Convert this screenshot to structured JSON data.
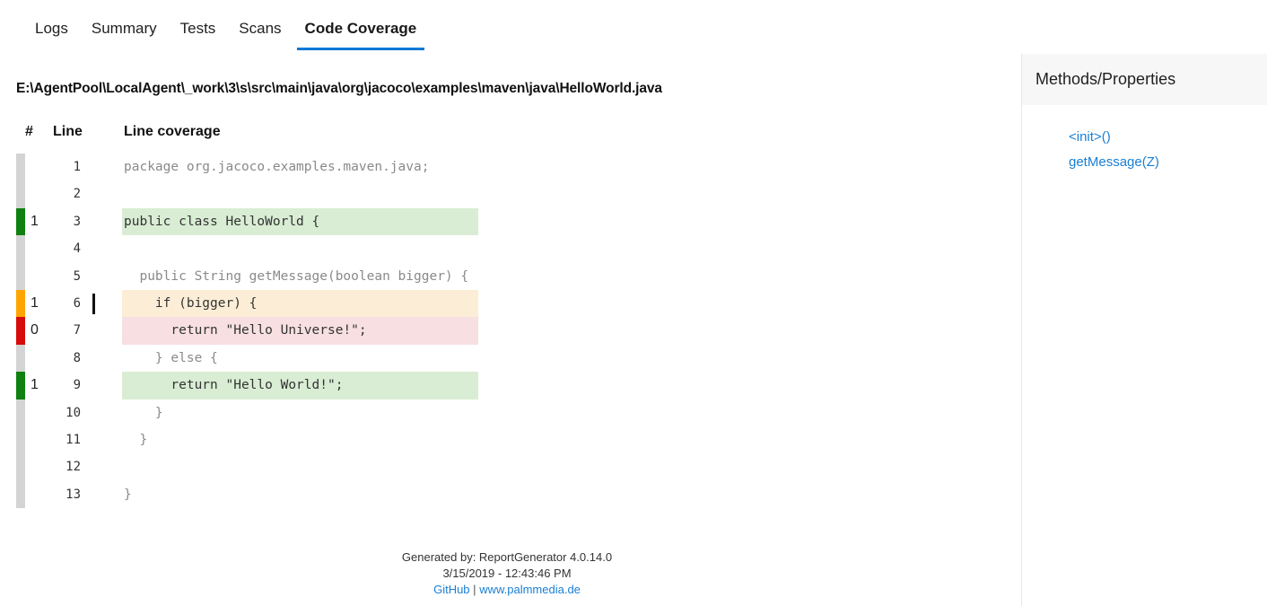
{
  "tabs": [
    {
      "label": "Logs",
      "active": false
    },
    {
      "label": "Summary",
      "active": false
    },
    {
      "label": "Tests",
      "active": false
    },
    {
      "label": "Scans",
      "active": false
    },
    {
      "label": "Code Coverage",
      "active": true
    }
  ],
  "file": {
    "path": "E:\\AgentPool\\LocalAgent\\_work\\3\\s\\src\\main\\java\\org\\jacoco\\examples\\maven\\java\\HelloWorld.java"
  },
  "table": {
    "headers": {
      "hash": "#",
      "line": "Line",
      "coverage": "Line coverage"
    },
    "rows": [
      {
        "status": "gray",
        "hits": "",
        "line": "1",
        "code": "package org.jacoco.examples.maven.java;",
        "cov": "none-code",
        "branch": false
      },
      {
        "status": "gray",
        "hits": "",
        "line": "2",
        "code": "",
        "cov": "none-code",
        "branch": false
      },
      {
        "status": "green",
        "hits": "1",
        "line": "3",
        "code": "public class HelloWorld {",
        "cov": "full",
        "branch": false
      },
      {
        "status": "gray",
        "hits": "",
        "line": "4",
        "code": "",
        "cov": "none-code",
        "branch": false
      },
      {
        "status": "gray",
        "hits": "",
        "line": "5",
        "code": "  public String getMessage(boolean bigger) {",
        "cov": "none-code",
        "branch": false
      },
      {
        "status": "orange",
        "hits": "1",
        "line": "6",
        "code": "    if (bigger) {",
        "cov": "partial",
        "branch": true
      },
      {
        "status": "red",
        "hits": "0",
        "line": "7",
        "code": "      return \"Hello Universe!\";",
        "cov": "uncovered",
        "branch": false
      },
      {
        "status": "gray",
        "hits": "",
        "line": "8",
        "code": "    } else {",
        "cov": "none-code",
        "branch": false
      },
      {
        "status": "green",
        "hits": "1",
        "line": "9",
        "code": "      return \"Hello World!\";",
        "cov": "full",
        "branch": false
      },
      {
        "status": "gray",
        "hits": "",
        "line": "10",
        "code": "    }",
        "cov": "none-code",
        "branch": false
      },
      {
        "status": "gray",
        "hits": "",
        "line": "11",
        "code": "  }",
        "cov": "none-code",
        "branch": false
      },
      {
        "status": "gray",
        "hits": "",
        "line": "12",
        "code": "",
        "cov": "none-code",
        "branch": false
      },
      {
        "status": "gray",
        "hits": "",
        "line": "13",
        "code": "}",
        "cov": "none-code",
        "branch": false
      }
    ]
  },
  "sidebar": {
    "title": "Methods/Properties",
    "methods": [
      {
        "label": "<init>()"
      },
      {
        "label": "getMessage(Z)"
      }
    ]
  },
  "footer": {
    "generated_by": "Generated by: ReportGenerator 4.0.14.0",
    "timestamp": "3/15/2019 - 12:43:46 PM",
    "link_github": "GitHub",
    "separator": "|",
    "link_site": "www.palmmedia.de"
  },
  "colors": {
    "accent": "#0078d4",
    "covered": "#108010",
    "partial": "#ffa500",
    "uncovered": "#d70b0b",
    "neutral": "#d4d4d4",
    "covered_bg": "#d9edd4",
    "partial_bg": "#fceed6",
    "uncovered_bg": "#f7dfe2",
    "link": "#1a7fd4"
  }
}
